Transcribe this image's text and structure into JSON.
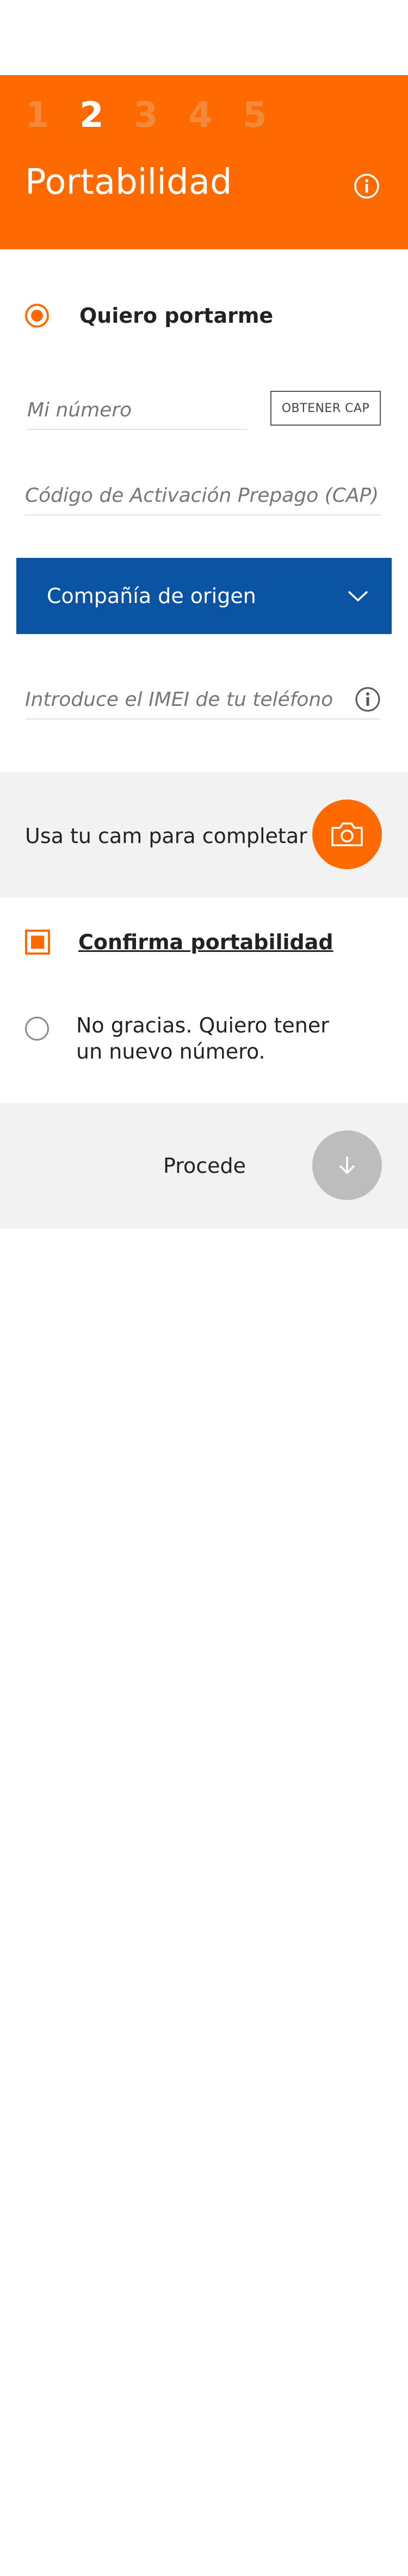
{
  "header": {
    "steps": [
      "1",
      "2",
      "3",
      "4",
      "5"
    ],
    "active_step": "2",
    "title": "Portabilidad",
    "info_icon": "info-icon"
  },
  "portability": {
    "option_port_label": "Quiero portarme",
    "my_number_placeholder": "Mi número",
    "get_cap_button": "OBTENER CAP",
    "cap_placeholder": "Código de Activación Prepago (CAP)",
    "company_select_label": "Compañía de origen",
    "imei_placeholder": "Introduce el IMEI de tu teléfono"
  },
  "camera": {
    "label": "Usa tu cam para completar",
    "icon": "camera-icon"
  },
  "confirm": {
    "label": "Confirma portabilidad",
    "checked": true
  },
  "new_number": {
    "label_line1": "No gracias. Quiero tener",
    "label_line2": "un nuevo número."
  },
  "proceed": {
    "label": "Procede",
    "icon": "arrow-down-icon"
  },
  "colors": {
    "brand_orange": "#ff6a00",
    "select_blue": "#0b53a3",
    "band_gray": "#f2f2f2",
    "disabled_gray": "#bdbdbd"
  }
}
